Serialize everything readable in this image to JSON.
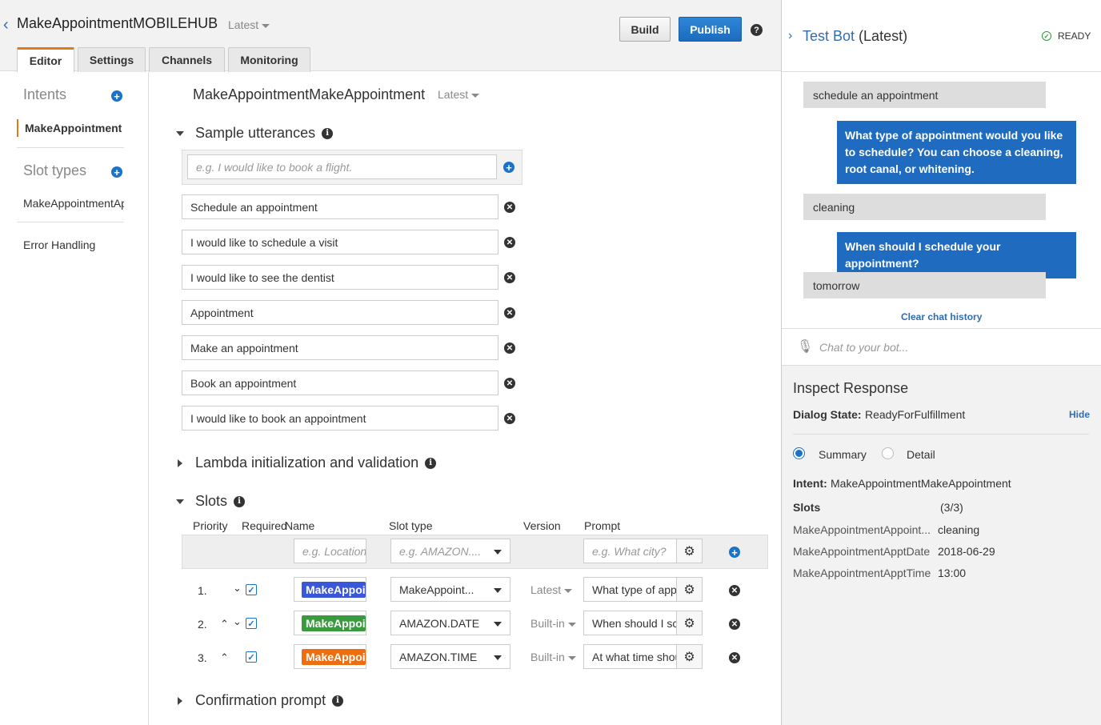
{
  "header": {
    "bot_name": "MakeAppointmentMOBILEHUB",
    "version": "Latest",
    "build_label": "Build",
    "publish_label": "Publish",
    "tabs": [
      "Editor",
      "Settings",
      "Channels",
      "Monitoring"
    ]
  },
  "leftnav": {
    "intents_label": "Intents",
    "intent_items": [
      "MakeAppointment"
    ],
    "slot_types_label": "Slot types",
    "slot_type_items": [
      "MakeAppointmentAp"
    ],
    "error_handling_label": "Error Handling"
  },
  "intent": {
    "name": "MakeAppointmentMakeAppointment",
    "version": "Latest"
  },
  "utterances": {
    "section_label": "Sample utterances",
    "placeholder": "e.g. I would like to book a flight.",
    "items": [
      "Schedule an appointment",
      "I would like to schedule a visit",
      "I would like to see the dentist",
      "Appointment",
      "Make an appointment",
      "Book an appointment",
      "I would like to book an appointment"
    ]
  },
  "lambda_section_label": "Lambda initialization and validation",
  "slots": {
    "section_label": "Slots",
    "columns": [
      "Priority",
      "Required",
      "Name",
      "Slot type",
      "Version",
      "Prompt"
    ],
    "new_row": {
      "name_placeholder": "e.g. Location",
      "type_placeholder": "e.g. AMAZON....",
      "prompt_placeholder": "e.g. What city?"
    },
    "rows": [
      {
        "priority": "1.",
        "name": "MakeAppointmentAppointmentType",
        "type": "MakeAppoint...",
        "version": "Latest",
        "prompt": "What type of appointment would you like to schedule?",
        "color": "#3b57d9"
      },
      {
        "priority": "2.",
        "name": "MakeAppointmentApptDate",
        "type": "AMAZON.DATE",
        "version": "Built-in",
        "prompt": "When should I schedule your appointment?",
        "color": "#3a9b3e"
      },
      {
        "priority": "3.",
        "name": "MakeAppointmentApptTime",
        "type": "AMAZON.TIME",
        "version": "Built-in",
        "prompt": "At what time should I schedule your appointment?",
        "color": "#ee6d0e"
      }
    ]
  },
  "confirmation_section_label": "Confirmation prompt",
  "testbot": {
    "title": "Test Bot",
    "title_suffix": "(Latest)",
    "status": "READY",
    "messages": [
      {
        "from": "user",
        "text": "schedule an appointment"
      },
      {
        "from": "bot",
        "text": "What type of appointment would you like to schedule? You can choose a cleaning, root canal, or whitening."
      },
      {
        "from": "user",
        "text": "cleaning"
      },
      {
        "from": "bot",
        "text": "When should I schedule your appointment?"
      },
      {
        "from": "user",
        "text": "tomorrow"
      }
    ],
    "clear_label": "Clear chat history",
    "chat_placeholder": "Chat to your bot..."
  },
  "inspect": {
    "title": "Inspect Response",
    "dialog_state_label": "Dialog State:",
    "dialog_state": "ReadyForFulfillment",
    "hide_label": "Hide",
    "view_options": [
      "Summary",
      "Detail"
    ],
    "intent_label": "Intent:",
    "intent_value": "MakeAppointmentMakeAppointment",
    "slots_label": "Slots",
    "slots_count": "(3/3)",
    "slot_values": [
      {
        "name": "MakeAppointmentAppoint...",
        "value": "cleaning"
      },
      {
        "name": "MakeAppointmentApptDate",
        "value": "2018-06-29"
      },
      {
        "name": "MakeAppointmentApptTime",
        "value": "13:00"
      }
    ]
  },
  "colors": {
    "accent_blue": "#1a73c9",
    "tab_active_border": "#e07b17",
    "ready_green": "#2e9b3a"
  }
}
